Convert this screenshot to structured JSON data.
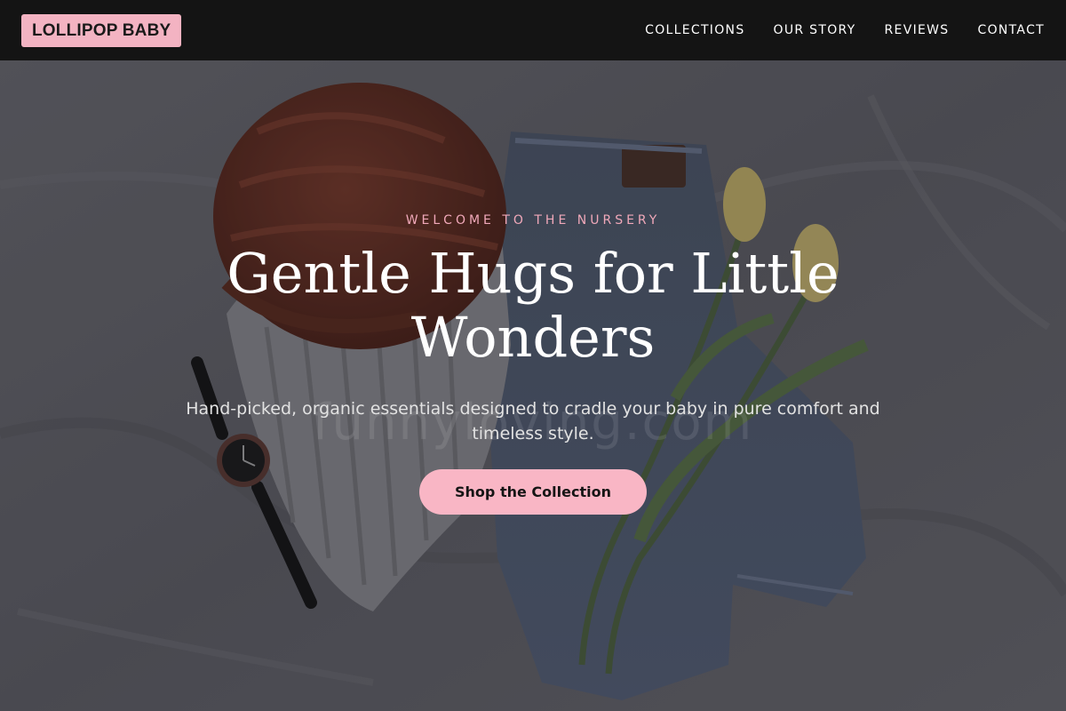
{
  "brand": {
    "logo_text": "LOLLIPOP BABY",
    "logo_bg": "#f3b3c2"
  },
  "nav": {
    "items": [
      {
        "label": "COLLECTIONS"
      },
      {
        "label": "OUR STORY"
      },
      {
        "label": "REVIEWS"
      },
      {
        "label": "CONTACT"
      }
    ]
  },
  "hero": {
    "eyebrow": "WELCOME TO THE NURSERY",
    "headline": "Gentle Hugs for Little Wonders",
    "subtext": "Hand-picked, organic essentials designed to cradle your baby in pure comfort and timeless style.",
    "cta_label": "Shop the Collection",
    "watermark_text": "funnyloving.com",
    "background_image_icon": "flatlay-photo-icon"
  },
  "colors": {
    "header_bg": "#141414",
    "accent_pink": "#f9b6c5",
    "eyebrow_pink": "#f0a8b9"
  }
}
